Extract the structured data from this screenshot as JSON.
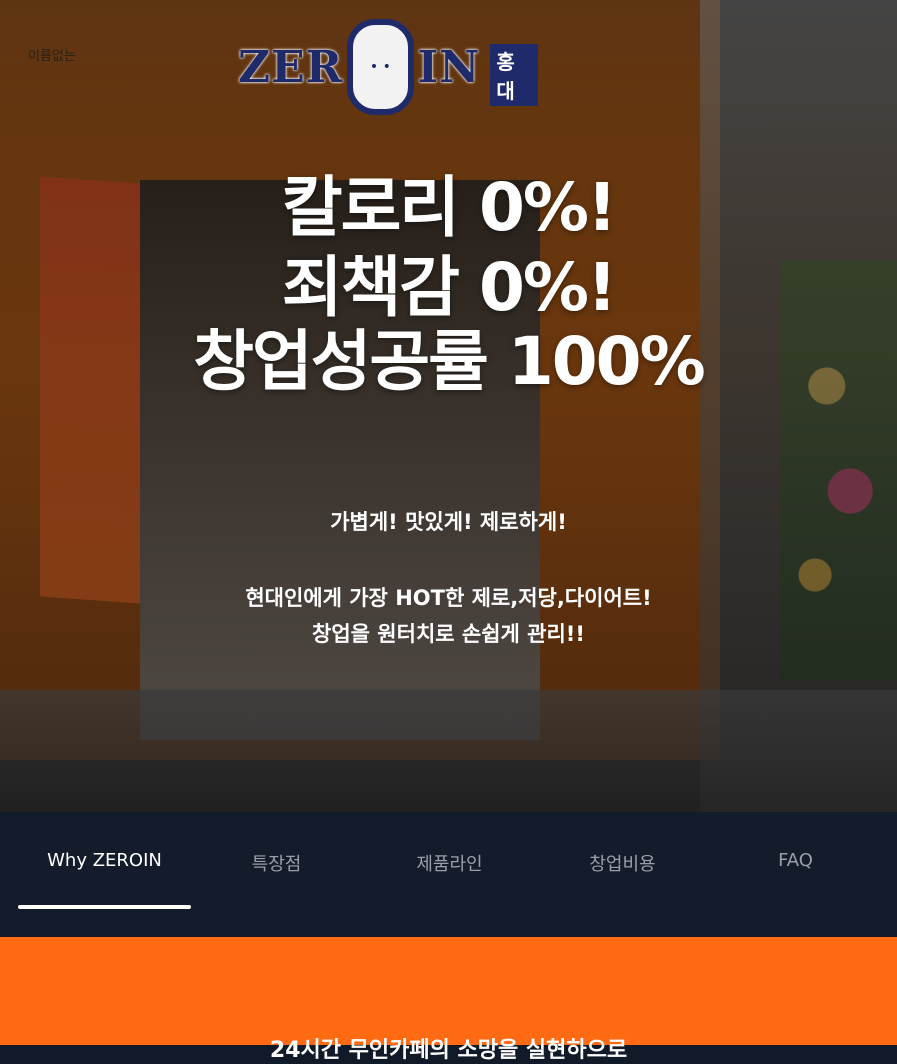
{
  "hero": {
    "corner_label": "이름없는",
    "logo": {
      "word1": "ZER",
      "o_mark": "• •",
      "word2": "IN",
      "branch": "홍대"
    },
    "headline": [
      "칼로리 0%!",
      "죄책감 0%!",
      "창업성공률 100%"
    ],
    "tagline": "가볍게! 맛있게! 제로하게!",
    "desc": [
      "현대인에게 가장 HOT한 제로,저당,다이어트!",
      "창업을 원터치로 손쉽게 관리!!"
    ]
  },
  "nav": {
    "tabs": [
      {
        "label": "Why ZEROIN",
        "active": true
      },
      {
        "label": "특장점",
        "active": false
      },
      {
        "label": "제품라인",
        "active": false
      },
      {
        "label": "창업비용",
        "active": false
      },
      {
        "label": "FAQ",
        "active": false
      }
    ]
  },
  "section": {
    "peek_text": "24시간 무인카페의 소망을 실현하으로"
  },
  "colors": {
    "nav_bg": "#141b2b",
    "accent_orange": "#ff6a13",
    "active_tab": "#ffffff",
    "inactive_tab": "#9aa0ab"
  }
}
